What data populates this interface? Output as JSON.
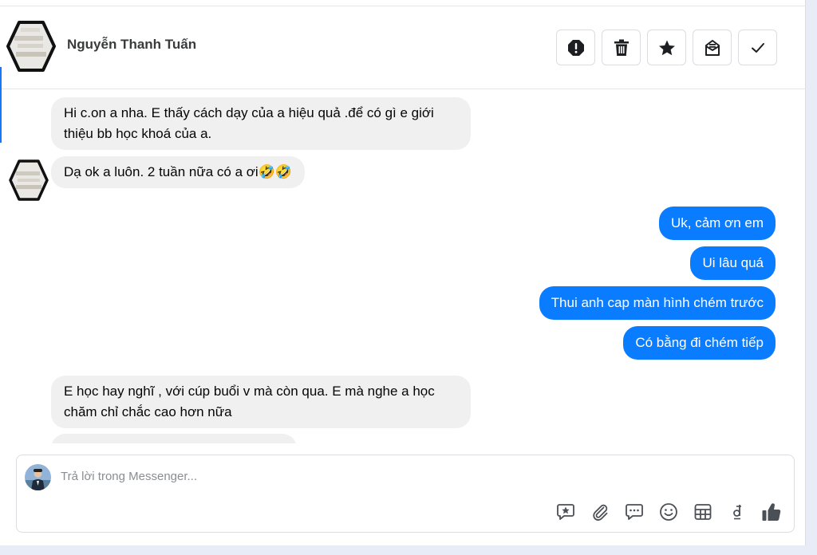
{
  "contact": {
    "name": "Nguyễn Thanh Tuấn"
  },
  "header_actions": [
    {
      "icon": "alert-icon",
      "label": "Spam"
    },
    {
      "icon": "trash-icon",
      "label": "Delete"
    },
    {
      "icon": "star-icon",
      "label": "Star"
    },
    {
      "icon": "mark-unread-icon",
      "label": "Mark as unread"
    },
    {
      "icon": "check-icon",
      "label": "Done"
    }
  ],
  "messages": [
    {
      "id": "m1",
      "side": "incoming",
      "text": "Hi c.on a nha. E thấy cách dạy của a hiệu quả .để có gì e giới thiệu bb học khoá của a."
    },
    {
      "id": "m2",
      "side": "incoming",
      "text": "Dạ ok a luôn. 2 tuần nữa có a ơi🤣🤣"
    },
    {
      "id": "m3",
      "side": "outgoing",
      "text": "Uk, cảm ơn em"
    },
    {
      "id": "m4",
      "side": "outgoing",
      "text": "Ui lâu quá"
    },
    {
      "id": "m5",
      "side": "outgoing",
      "text": "Thui anh cap màn hình chém trước"
    },
    {
      "id": "m6",
      "side": "outgoing",
      "text": "Có bằng đi chém tiếp"
    },
    {
      "id": "m7",
      "side": "incoming",
      "text": "E học hay nghĩ , với cúp buổi v mà còn qua. E mà nghe a học chăm chỉ chắc cao hơn nữa"
    }
  ],
  "composer": {
    "placeholder": "Trả lời trong Messenger..."
  },
  "composer_tools": [
    "saved-reply-icon",
    "attachment-icon",
    "chat-bubble-icon",
    "emoji-icon",
    "table-icon",
    "dong-currency-icon",
    "thumbs-up-icon"
  ],
  "colors": {
    "outgoing_bubble": "#0a7cff",
    "incoming_bubble": "#f0f0f0",
    "accent": "#1877f2",
    "page_background": "#e7ecf7"
  }
}
